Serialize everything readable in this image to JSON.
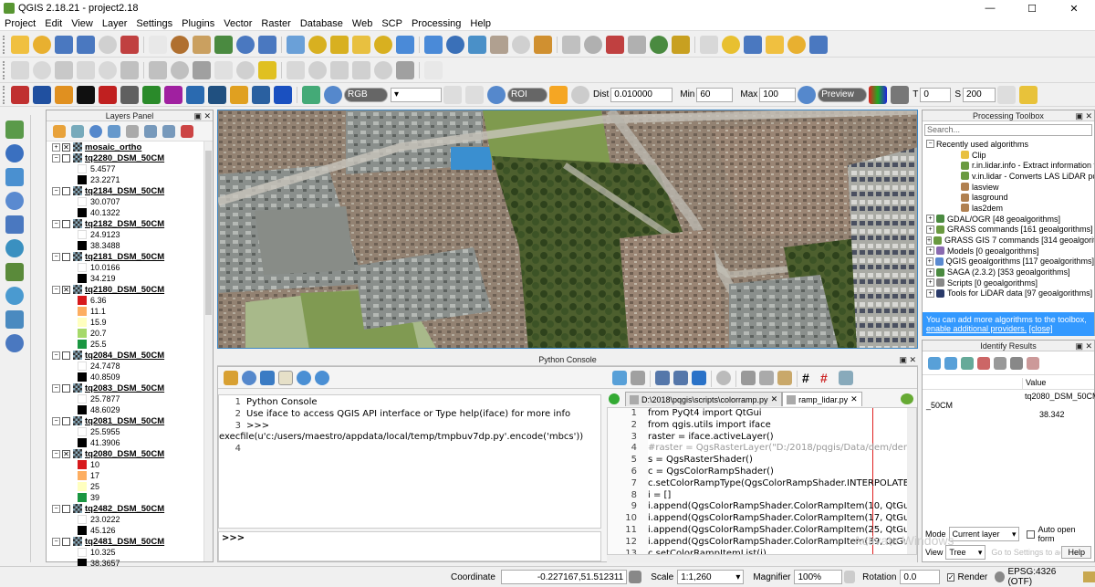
{
  "window": {
    "title": "QGIS 2.18.21 - project2.18",
    "min_icon": "—",
    "max_icon": "☐",
    "close_icon": "✕"
  },
  "menu": [
    "Project",
    "Edit",
    "View",
    "Layer",
    "Settings",
    "Plugins",
    "Vector",
    "Raster",
    "Database",
    "Web",
    "SCP",
    "Processing",
    "Help"
  ],
  "toolbar3": {
    "rgb_label": "RGB",
    "roi_label": "ROI",
    "dist_label": "Dist",
    "dist_value": "0.010000",
    "min_label": "Min",
    "min_value": "60",
    "max_label": "Max",
    "max_value": "100",
    "preview_label": "Preview",
    "t_label": "T",
    "t_value": "0",
    "s_label": "S",
    "s_value": "200"
  },
  "layers_panel": {
    "title": "Layers Panel",
    "layers": [
      {
        "name": "mosaic_ortho",
        "checked": true,
        "expanded": false,
        "legend": []
      },
      {
        "name": "tq2280_DSM_50CM",
        "checked": false,
        "expanded": true,
        "legend": [
          {
            "color": "#ffffff",
            "label": "5.4577"
          },
          {
            "color": "#000000",
            "label": "23.2271"
          }
        ]
      },
      {
        "name": "tq2184_DSM_50CM",
        "checked": false,
        "expanded": true,
        "legend": [
          {
            "color": "#ffffff",
            "label": "30.0707"
          },
          {
            "color": "#000000",
            "label": "40.1322"
          }
        ]
      },
      {
        "name": "tq2182_DSM_50CM",
        "checked": false,
        "expanded": true,
        "legend": [
          {
            "color": "#ffffff",
            "label": "24.9123"
          },
          {
            "color": "#000000",
            "label": "38.3488"
          }
        ]
      },
      {
        "name": "tq2181_DSM_50CM",
        "checked": false,
        "expanded": true,
        "legend": [
          {
            "color": "#ffffff",
            "label": "10.0166"
          },
          {
            "color": "#000000",
            "label": "34.219"
          }
        ]
      },
      {
        "name": "tq2180_DSM_50CM",
        "checked": true,
        "expanded": true,
        "legend": [
          {
            "color": "#d7191c",
            "label": "6.36"
          },
          {
            "color": "#fdae61",
            "label": "11.1"
          },
          {
            "color": "#ffffbf",
            "label": "15.9"
          },
          {
            "color": "#a6d96a",
            "label": "20.7"
          },
          {
            "color": "#1a9641",
            "label": "25.5"
          }
        ]
      },
      {
        "name": "tq2084_DSM_50CM",
        "checked": false,
        "expanded": true,
        "legend": [
          {
            "color": "#ffffff",
            "label": "24.7478"
          },
          {
            "color": "#000000",
            "label": "40.8509"
          }
        ]
      },
      {
        "name": "tq2083_DSM_50CM",
        "checked": false,
        "expanded": true,
        "legend": [
          {
            "color": "#ffffff",
            "label": "25.7877"
          },
          {
            "color": "#000000",
            "label": "48.6029"
          }
        ]
      },
      {
        "name": "tq2081_DSM_50CM",
        "checked": false,
        "expanded": true,
        "legend": [
          {
            "color": "#ffffff",
            "label": "25.5955"
          },
          {
            "color": "#000000",
            "label": "41.3906"
          }
        ]
      },
      {
        "name": "tq2080_DSM_50CM",
        "checked": true,
        "expanded": true,
        "legend": [
          {
            "color": "#d7191c",
            "label": "10"
          },
          {
            "color": "#fdae61",
            "label": "17"
          },
          {
            "color": "#ffffbf",
            "label": "25"
          },
          {
            "color": "#1a9641",
            "label": "39"
          }
        ]
      },
      {
        "name": "tq2482_DSM_50CM",
        "checked": false,
        "expanded": true,
        "legend": [
          {
            "color": "#ffffff",
            "label": "23.0222"
          },
          {
            "color": "#000000",
            "label": "45.126"
          }
        ]
      },
      {
        "name": "tq2481_DSM_50CM",
        "checked": false,
        "expanded": true,
        "legend": [
          {
            "color": "#ffffff",
            "label": "10.325"
          },
          {
            "color": "#000000",
            "label": "38.3657"
          }
        ]
      }
    ]
  },
  "python_console": {
    "title": "Python Console",
    "console_lines": [
      {
        "n": "1",
        "text": "Python Console"
      },
      {
        "n": "2",
        "text": "Use iface to access QGIS API interface or Type help(iface) for more info"
      },
      {
        "n": "3",
        "text": ">>> execfile(u'c:/users/maestro/appdata/local/temp/tmpbuv7dp.py'.encode('mbcs'))"
      },
      {
        "n": "4",
        "text": ""
      }
    ],
    "prompt": ">>>",
    "editor_tabs": [
      "D:\\2018\\pqgis\\scripts\\colorramp.py",
      "ramp_lidar.py"
    ],
    "tab_close": "✕",
    "editor_lines": [
      {
        "n": "1",
        "text": "from PyQt4 import QtGui"
      },
      {
        "n": "2",
        "text": "from qgis.utils import iface"
      },
      {
        "n": "3",
        "text": "raster = iface.activeLayer()"
      },
      {
        "n": "4",
        "text": "#raster = QgsRasterLayer(\"D:/2018/pqgis/Data/dem/dem.tif\", \""
      },
      {
        "n": "5",
        "text": "s = QgsRasterShader()"
      },
      {
        "n": "6",
        "text": "c = QgsColorRampShader()"
      },
      {
        "n": "7",
        "text": "c.setColorRampType(QgsColorRampShader.INTERPOLATED)"
      },
      {
        "n": "8",
        "text": "i = []"
      },
      {
        "n": "9",
        "text": "i.append(QgsColorRampShader.ColorRampItem(10, QtGui.QColc"
      },
      {
        "n": "10",
        "text": "i.append(QgsColorRampShader.ColorRampItem(17, QtGui.QColc"
      },
      {
        "n": "11",
        "text": "i.append(QgsColorRampShader.ColorRampItem(25, QtGui.QColc"
      },
      {
        "n": "12",
        "text": "i.append(QgsColorRampShader.ColorRampItem(39, QtGui.QColc"
      },
      {
        "n": "13",
        "text": "c.setColorRampItemList(i)"
      }
    ]
  },
  "processing": {
    "title": "Processing Toolbox",
    "search_placeholder": "Search...",
    "recent": "Recently used algorithms",
    "recent_items": [
      "Clip",
      "r.in.lidar.info - Extract information fr...",
      "v.in.lidar - Converts LAS LiDAR poin...",
      "lasview",
      "lasground",
      "las2dem"
    ],
    "groups": [
      "GDAL/OGR [48 geoalgorithms]",
      "GRASS commands [161 geoalgorithms]",
      "GRASS GIS 7 commands [314 geoalgorithms]",
      "Models [0 geoalgorithms]",
      "QGIS geoalgorithms [117 geoalgorithms]",
      "SAGA (2.3.2) [353 geoalgorithms]",
      "Scripts [0 geoalgorithms]",
      "Tools for LiDAR data [97 geoalgorithms]"
    ],
    "note": "You can add more algorithms to the toolbox,",
    "note_link": "enable additional providers.",
    "note_close": "[close]"
  },
  "identify": {
    "title": "Identify Results",
    "col_value": "Value",
    "layer_value": "tq2080_DSM_50CM",
    "feature": "_50CM",
    "value": "38.342",
    "mode_label": "Mode",
    "mode_value": "Current layer",
    "auto_open": "Auto open form",
    "view_label": "View",
    "view_value": "Tree",
    "help_label": "Help",
    "watermark": "Go to Settings to activate Windows."
  },
  "watermark_title": "Activate Windows",
  "status": {
    "coord_label": "Coordinate",
    "coord_value": "-0.227167,51.512311",
    "scale_label": "Scale",
    "scale_value": "1:1,260",
    "magnifier_label": "Magnifier",
    "magnifier_value": "100%",
    "rotation_label": "Rotation",
    "rotation_value": "0.0",
    "render_label": "Render",
    "crs": "EPSG:4326 (OTF)"
  }
}
